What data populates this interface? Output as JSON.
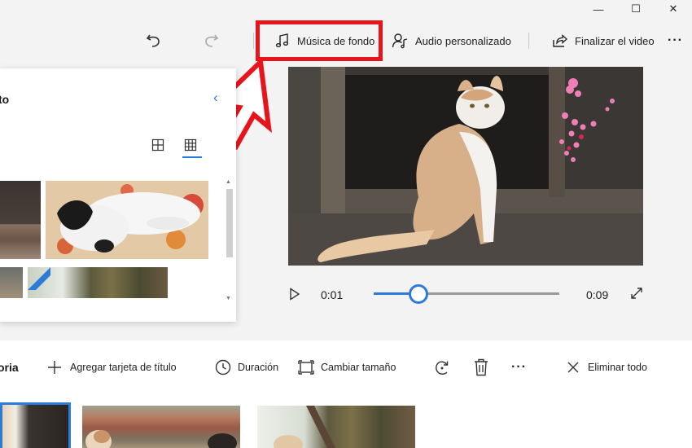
{
  "toolbar": {
    "music_label": "Música de fondo",
    "custom_audio_label": "Audio personalizado",
    "finish_label": "Finalizar el video",
    "more": "···"
  },
  "window_controls": {
    "minimize": "—",
    "maximize": "☐",
    "close": "✕"
  },
  "library": {
    "title": "to",
    "back": "‹"
  },
  "playback": {
    "current_time": "0:01",
    "total_time": "0:09",
    "progress": 0.24
  },
  "storyboard": {
    "title": "oria",
    "add_title_card": "Agregar tarjeta de título",
    "duration": "Duración",
    "resize": "Cambiar tamaño",
    "more": "···",
    "remove_all": "Eliminar todo"
  },
  "colors": {
    "accent": "#2b7bd8",
    "highlight": "#e8141b"
  }
}
